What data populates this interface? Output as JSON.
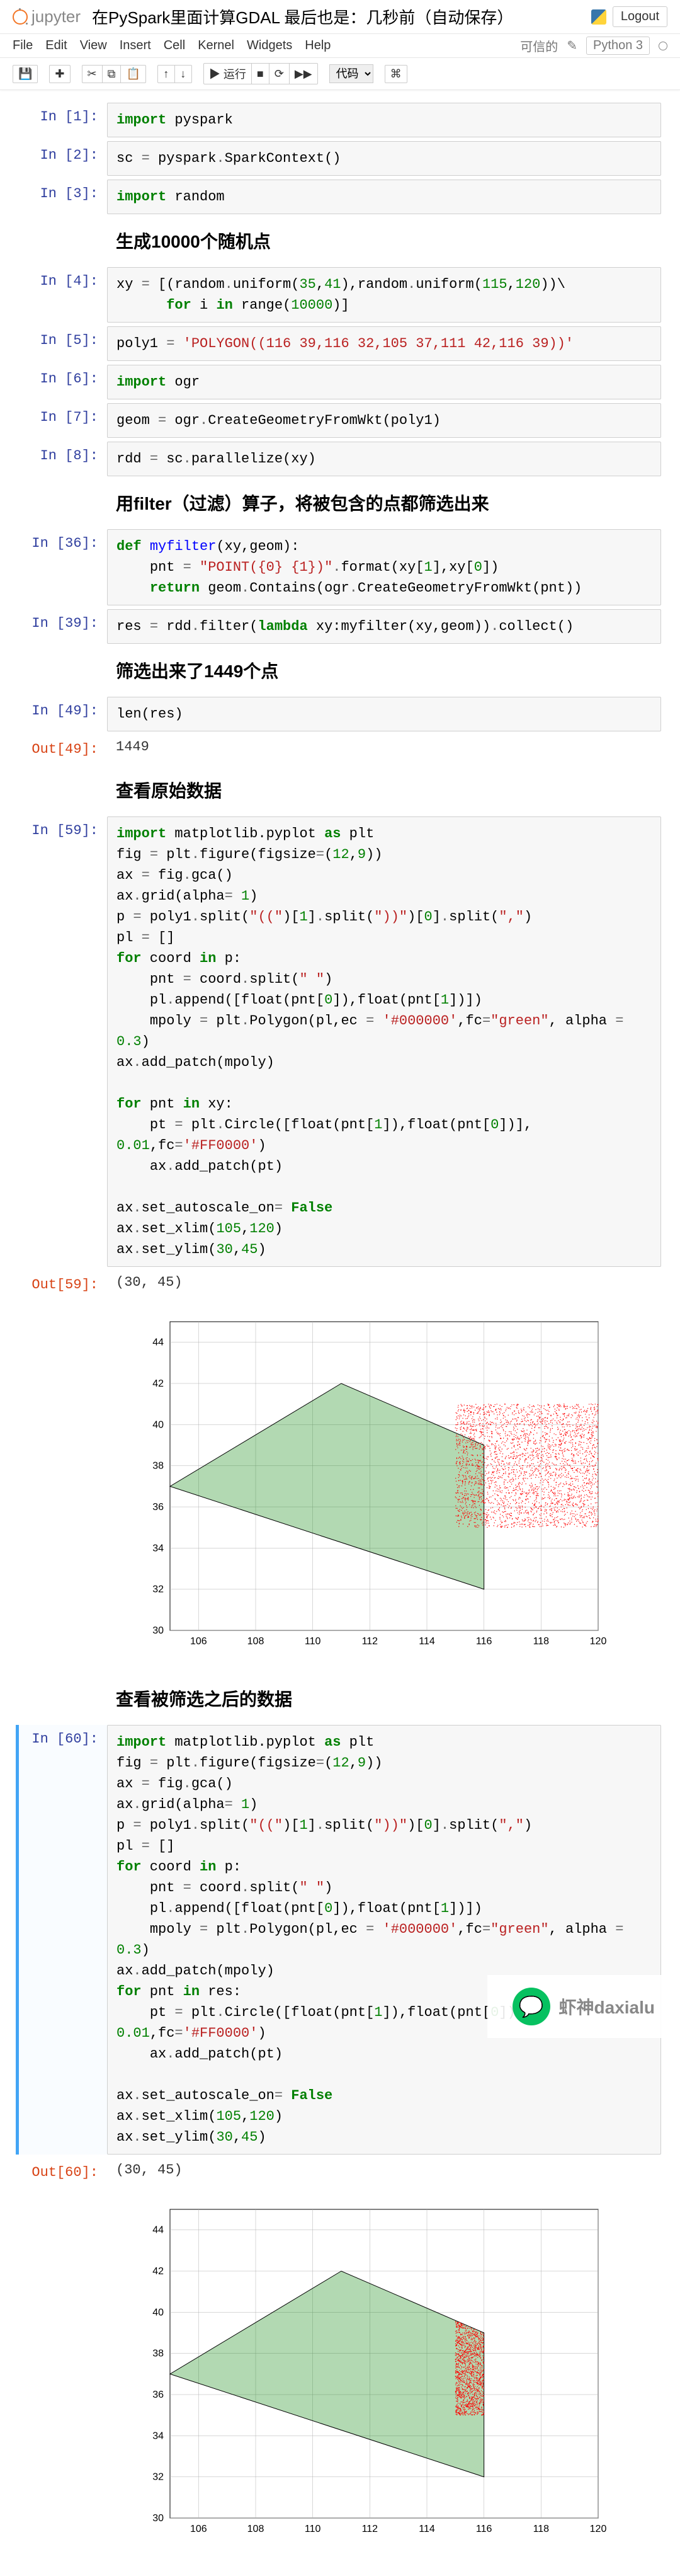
{
  "header": {
    "logo_text": "jupyter",
    "notebook_name": "在PySpark里面计算GDAL 最后也是：几秒前（自动保存）",
    "logout": "Logout"
  },
  "menubar": {
    "items": [
      "File",
      "Edit",
      "View",
      "Insert",
      "Cell",
      "Kernel",
      "Widgets",
      "Help"
    ],
    "trusted": "可信的",
    "kernel": "Python 3"
  },
  "toolbar": {
    "save": "💾",
    "add": "✚",
    "cut": "✂",
    "copy": "⧉",
    "paste": "📋",
    "up": "↑",
    "down": "↓",
    "run": "▶ 运行",
    "stop": "■",
    "restart": "⟳",
    "forward": "▶▶",
    "cell_type": "代码",
    "palette": "⌘"
  },
  "cells": [
    {
      "type": "code",
      "prompt": "In [1]:",
      "html": "<span class='kw'>import</span> pyspark"
    },
    {
      "type": "code",
      "prompt": "In [2]:",
      "html": "sc <span class='op'>=</span> pyspark<span class='op'>.</span>SparkContext()"
    },
    {
      "type": "code",
      "prompt": "In [3]:",
      "html": "<span class='kw'>import</span> random"
    },
    {
      "type": "md",
      "heading": "生成10000个随机点"
    },
    {
      "type": "code",
      "prompt": "In [4]:",
      "html": "xy <span class='op'>=</span> [(random<span class='op'>.</span>uniform(<span class='num'>35</span>,<span class='num'>41</span>),random<span class='op'>.</span>uniform(<span class='num'>115</span>,<span class='num'>120</span>))\\\n      <span class='kw'>for</span> i <span class='kw'>in</span> range(<span class='num'>10000</span>)]"
    },
    {
      "type": "code",
      "prompt": "In [5]:",
      "html": "poly1 <span class='op'>=</span> <span class='str'>'POLYGON((116 39,116 32,105 37,111 42,116 39))'</span>"
    },
    {
      "type": "code",
      "prompt": "In [6]:",
      "html": "<span class='kw'>import</span> ogr"
    },
    {
      "type": "code",
      "prompt": "In [7]:",
      "html": "geom <span class='op'>=</span> ogr<span class='op'>.</span>CreateGeometryFromWkt(poly1)"
    },
    {
      "type": "code",
      "prompt": "In [8]:",
      "html": "rdd <span class='op'>=</span> sc<span class='op'>.</span>parallelize(xy)"
    },
    {
      "type": "md",
      "heading": "用filter（过滤）算子，将被包含的点都筛选出来"
    },
    {
      "type": "code",
      "prompt": "In [36]:",
      "html": "<span class='kw'>def</span> <span class='bn'>myfilter</span>(xy,geom):\n    pnt <span class='op'>=</span> <span class='str'>\"POINT({0} {1})\"</span><span class='op'>.</span>format(xy[<span class='num'>1</span>],xy[<span class='num'>0</span>])\n    <span class='kw'>return</span> geom<span class='op'>.</span>Contains(ogr<span class='op'>.</span>CreateGeometryFromWkt(pnt))"
    },
    {
      "type": "code",
      "prompt": "In [39]:",
      "html": "res <span class='op'>=</span> rdd<span class='op'>.</span>filter(<span class='kw'>lambda</span> xy:myfilter(xy,geom))<span class='op'>.</span>collect()"
    },
    {
      "type": "md",
      "heading": "筛选出来了1449个点"
    },
    {
      "type": "code",
      "prompt": "In [49]:",
      "html": "len(res)"
    },
    {
      "type": "output",
      "prompt": "Out[49]:",
      "text": "1449"
    },
    {
      "type": "md",
      "heading": "查看原始数据"
    },
    {
      "type": "code",
      "prompt": "In [59]:",
      "html": "<span class='kw'>import</span> matplotlib.pyplot <span class='kw'>as</span> plt\nfig <span class='op'>=</span> plt<span class='op'>.</span>figure(figsize<span class='op'>=</span>(<span class='num'>12</span>,<span class='num'>9</span>))\nax <span class='op'>=</span> fig<span class='op'>.</span>gca()\nax<span class='op'>.</span>grid(alpha<span class='op'>=</span> <span class='num'>1</span>)\np <span class='op'>=</span> poly1<span class='op'>.</span>split(<span class='str'>\"((\"</span>)[<span class='num'>1</span>]<span class='op'>.</span>split(<span class='str'>\"))\"</span>)[<span class='num'>0</span>]<span class='op'>.</span>split(<span class='str'>\",\"</span>)\npl <span class='op'>=</span> []\n<span class='kw'>for</span> coord <span class='kw'>in</span> p:\n    pnt <span class='op'>=</span> coord<span class='op'>.</span>split(<span class='str'>\" \"</span>)\n    pl<span class='op'>.</span>append([float(pnt[<span class='num'>0</span>]),float(pnt[<span class='num'>1</span>])])\n    mpoly <span class='op'>=</span> plt<span class='op'>.</span>Polygon(pl,ec <span class='op'>=</span> <span class='str'>'#000000'</span>,fc<span class='op'>=</span><span class='str'>\"green\"</span>, alpha <span class='op'>=</span> <span class='num'>0.3</span>)\nax<span class='op'>.</span>add_patch(mpoly)\n\n<span class='kw'>for</span> pnt <span class='kw'>in</span> xy:\n    pt <span class='op'>=</span> plt<span class='op'>.</span>Circle([float(pnt[<span class='num'>1</span>]),float(pnt[<span class='num'>0</span>])], <span class='num'>0.01</span>,fc<span class='op'>=</span><span class='str'>'#FF0000'</span>)\n    ax<span class='op'>.</span>add_patch(pt)\n\nax<span class='op'>.</span>set_autoscale_on<span class='op'>=</span> <span class='kw'>False</span>\nax<span class='op'>.</span>set_xlim(<span class='num'>105</span>,<span class='num'>120</span>)\nax<span class='op'>.</span>set_ylim(<span class='num'>30</span>,<span class='num'>45</span>)"
    },
    {
      "type": "output",
      "prompt": "Out[59]:",
      "text": "(30, 45)"
    },
    {
      "type": "plot",
      "chart_idx": 0
    },
    {
      "type": "md",
      "heading": "查看被筛选之后的数据"
    },
    {
      "type": "code",
      "prompt": "In [60]:",
      "selected": true,
      "html": "<span class='kw'>import</span> matplotlib.pyplot <span class='kw'>as</span> plt\nfig <span class='op'>=</span> plt<span class='op'>.</span>figure(figsize<span class='op'>=</span>(<span class='num'>12</span>,<span class='num'>9</span>))\nax <span class='op'>=</span> fig<span class='op'>.</span>gca()\nax<span class='op'>.</span>grid(alpha<span class='op'>=</span> <span class='num'>1</span>)\np <span class='op'>=</span> poly1<span class='op'>.</span>split(<span class='str'>\"((\"</span>)[<span class='num'>1</span>]<span class='op'>.</span>split(<span class='str'>\"))\"</span>)[<span class='num'>0</span>]<span class='op'>.</span>split(<span class='str'>\",\"</span>)\npl <span class='op'>=</span> []\n<span class='kw'>for</span> coord <span class='kw'>in</span> p:\n    pnt <span class='op'>=</span> coord<span class='op'>.</span>split(<span class='str'>\" \"</span>)\n    pl<span class='op'>.</span>append([float(pnt[<span class='num'>0</span>]),float(pnt[<span class='num'>1</span>])])\n    mpoly <span class='op'>=</span> plt<span class='op'>.</span>Polygon(pl,ec <span class='op'>=</span> <span class='str'>'#000000'</span>,fc<span class='op'>=</span><span class='str'>\"green\"</span>, alpha <span class='op'>=</span> <span class='num'>0.3</span>)\nax<span class='op'>.</span>add_patch(mpoly)\n<span class='kw'>for</span> pnt <span class='kw'>in</span> res:\n    pt <span class='op'>=</span> plt<span class='op'>.</span>Circle([float(pnt[<span class='num'>1</span>]),float(pnt[<span class='num'>0</span>])], <span class='num'>0.01</span>,fc<span class='op'>=</span><span class='str'>'#FF0000'</span>)\n    ax<span class='op'>.</span>add_patch(pt)\n\nax<span class='op'>.</span>set_autoscale_on<span class='op'>=</span> <span class='kw'>False</span>\nax<span class='op'>.</span>set_xlim(<span class='num'>105</span>,<span class='num'>120</span>)\nax<span class='op'>.</span>set_ylim(<span class='num'>30</span>,<span class='num'>45</span>)"
    },
    {
      "type": "output",
      "prompt": "Out[60]:",
      "text": "(30, 45)"
    },
    {
      "type": "plot",
      "chart_idx": 1
    }
  ],
  "chart_data": [
    {
      "type": "scatter+polygon",
      "xlim": [
        105,
        120
      ],
      "ylim": [
        30,
        45
      ],
      "xticks": [
        106,
        108,
        110,
        112,
        114,
        116,
        118,
        120
      ],
      "yticks": [
        30,
        32,
        34,
        36,
        38,
        40,
        42,
        44
      ],
      "polygon": [
        [
          116,
          39
        ],
        [
          116,
          32
        ],
        [
          105,
          37
        ],
        [
          111,
          42
        ],
        [
          116,
          39
        ]
      ],
      "poly_fc": "green",
      "poly_alpha": 0.3,
      "poly_ec": "#000000",
      "scatter": {
        "x_range": [
          115,
          120
        ],
        "y_range": [
          35,
          41
        ],
        "count": 10000,
        "color": "#FF0000",
        "r": 0.01
      }
    },
    {
      "type": "scatter+polygon",
      "xlim": [
        105,
        120
      ],
      "ylim": [
        30,
        45
      ],
      "xticks": [
        106,
        108,
        110,
        112,
        114,
        116,
        118,
        120
      ],
      "yticks": [
        30,
        32,
        34,
        36,
        38,
        40,
        42,
        44
      ],
      "polygon": [
        [
          116,
          39
        ],
        [
          116,
          32
        ],
        [
          105,
          37
        ],
        [
          111,
          42
        ],
        [
          116,
          39
        ]
      ],
      "poly_fc": "green",
      "poly_alpha": 0.3,
      "poly_ec": "#000000",
      "scatter": {
        "filtered_inside_polygon": true,
        "x_range": [
          115,
          116
        ],
        "y_range": [
          35,
          41
        ],
        "count": 1449,
        "color": "#FF0000",
        "r": 0.01
      }
    }
  ],
  "footer": {
    "text": "虾神daxialu"
  }
}
